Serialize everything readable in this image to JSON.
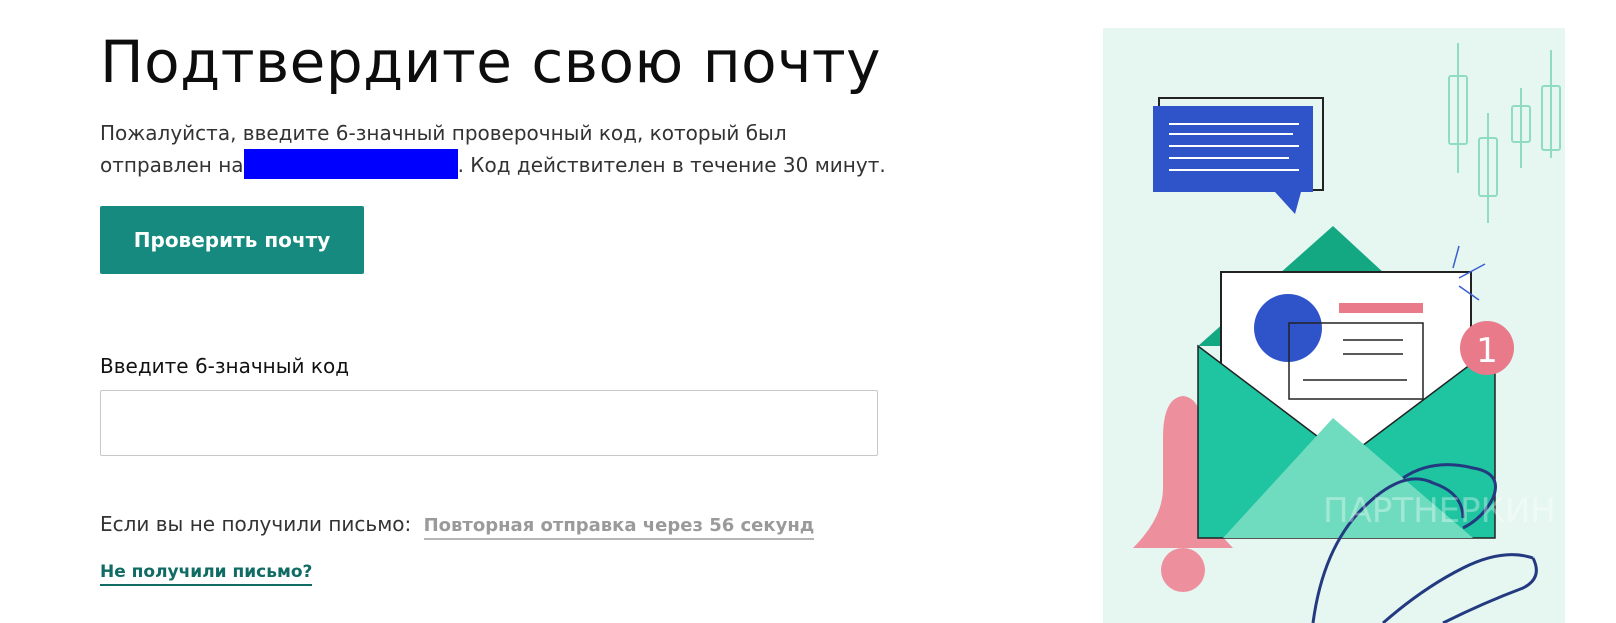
{
  "page": {
    "title": "Подтвердите свою почту",
    "description_before": "Пожалуйста, введите 6-значный проверочный код, который был отправлен на",
    "description_after": ". Код действителен в течение 30 минут.",
    "verify_button": "Проверить почту",
    "code_label": "Введите 6-значный код",
    "code_value": "",
    "resend_prompt": "Если вы не получили письмо:",
    "resend_timer": "Повторная отправка через 56 секунд",
    "no_mail_link": "Не получили письмо?"
  },
  "illustration": {
    "badge_count": "1",
    "watermark": "ПАРТНЕРКИН"
  },
  "colors": {
    "primary": "#168a7e",
    "link": "#0f6b63",
    "illustration_bg": "#e6f7f2",
    "envelope": "#1fc4a0",
    "chat": "#2f54c9",
    "badge": "#e87a8a"
  }
}
